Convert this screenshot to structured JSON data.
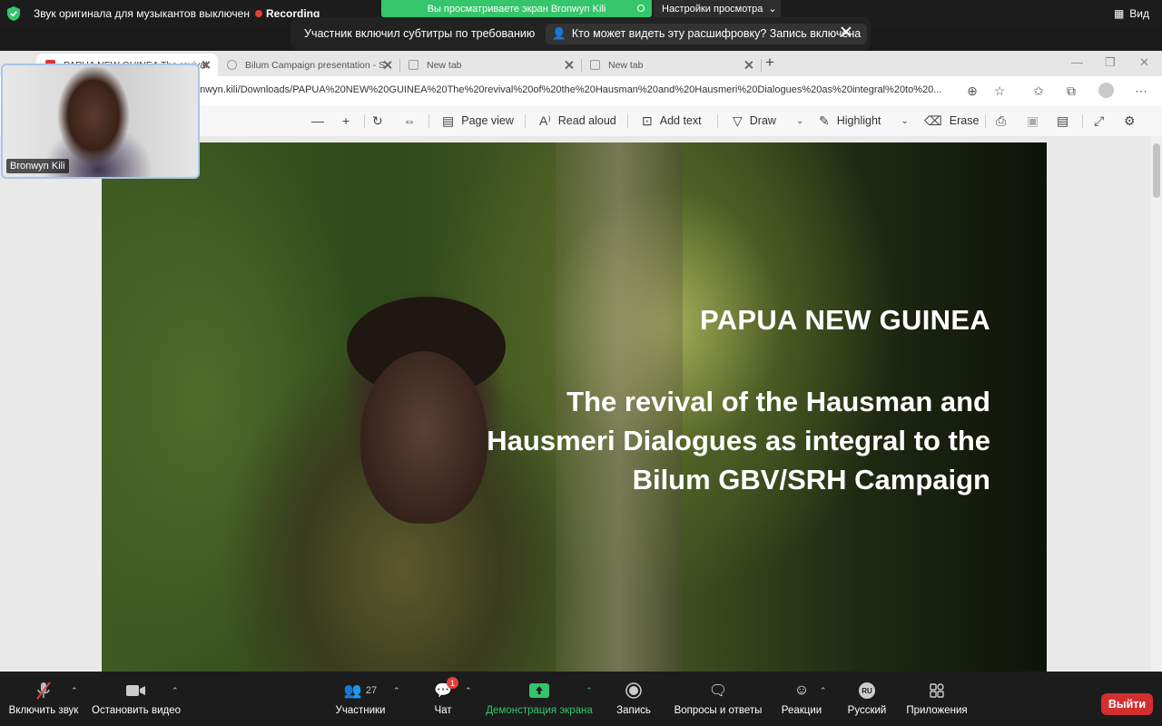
{
  "zoom_top": {
    "original_sound": "Звук оригинала для музыкантов выключен",
    "recording": "Recording",
    "viewing_banner": "Вы просматриваете экран Bronwyn Kili",
    "view_options": "Настройки просмотра",
    "view_menu": "Вид"
  },
  "caption_banner": {
    "message": "Участник включил субтитры по требованию",
    "who_can_see": "Кто может видеть эту расшифровку? Запись включена"
  },
  "browser": {
    "tabs": [
      {
        "label": "PAPUA NEW GUINEA The revival"
      },
      {
        "label": "Bilum Campaign presentation - S"
      },
      {
        "label": "New tab"
      },
      {
        "label": "New tab"
      }
    ],
    "url": "onwyn.kili/Downloads/PAPUA%20NEW%20GUINEA%20The%20revival%20of%20the%20Hausman%20and%20Hausmeri%20Dialogues%20as%20integral%20to%20..."
  },
  "pdf_toolbar": {
    "page_view": "Page view",
    "read_aloud": "Read aloud",
    "add_text": "Add text",
    "draw": "Draw",
    "highlight": "Highlight",
    "erase": "Erase"
  },
  "slide": {
    "title": "PAPUA NEW GUINEA",
    "subtitle": "The revival of the Hausman and Hausmeri Dialogues as integral to the Bilum GBV/SRH Campaign"
  },
  "self_view": {
    "name": "Bronwyn Kili"
  },
  "zoom_bottom": {
    "unmute": "Включить звук",
    "stop_video": "Остановить видео",
    "participants": "Участники",
    "participants_count": "27",
    "chat": "Чат",
    "chat_badge": "1",
    "share_screen": "Демонстрация экрана",
    "record": "Запись",
    "qa": "Вопросы и ответы",
    "reactions": "Реакции",
    "language": "Русский",
    "language_code": "RU",
    "apps": "Приложения",
    "leave": "Выйти"
  },
  "colors": {
    "zoom_bg": "#1c1c1c",
    "viewing_green": "#35c56b",
    "leave_red": "#d32f2f",
    "recording_red": "#e0403a"
  }
}
